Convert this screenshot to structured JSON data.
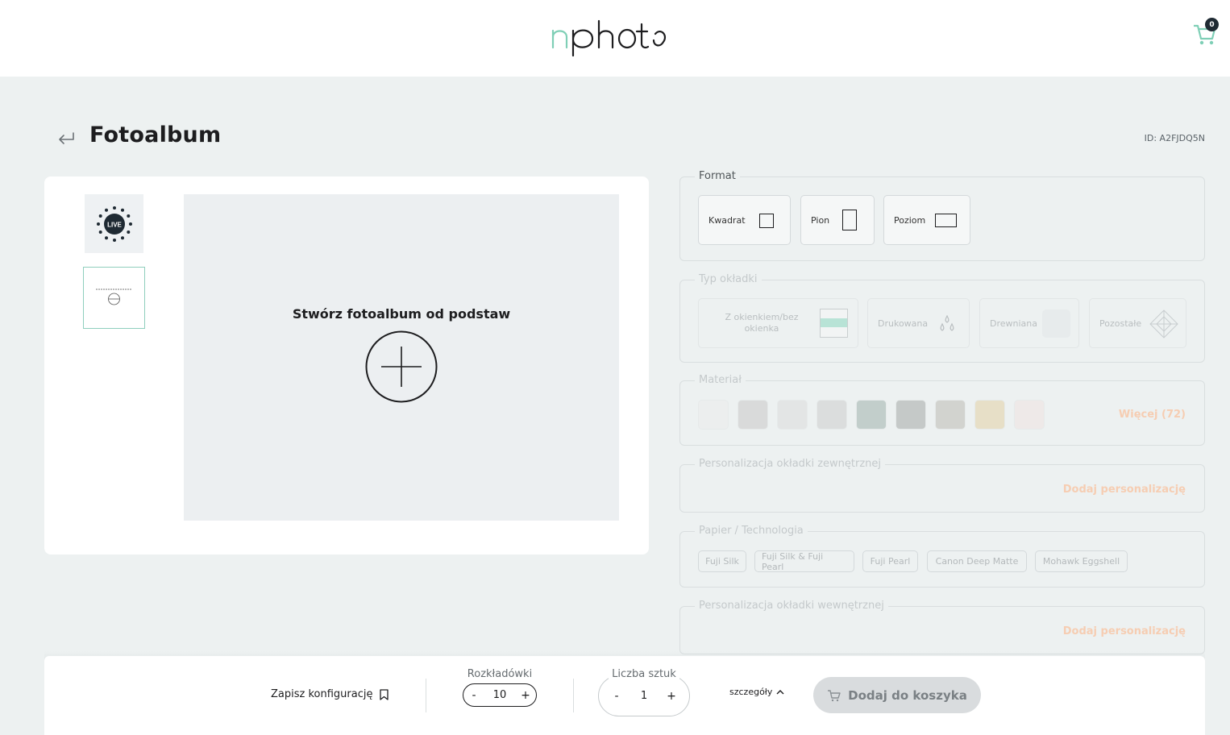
{
  "header": {
    "logo_alt": "nphoto",
    "cart_count": "0"
  },
  "page": {
    "title": "Fotoalbum",
    "id_text": "ID: A2FJDQ5N"
  },
  "preview": {
    "live_badge": "LIVE",
    "canvas_title": "Stwórz fotoalbum od podstaw"
  },
  "options": {
    "format": {
      "legend": "Format",
      "items": [
        {
          "label": "Kwadrat",
          "icon": "square-format-icon"
        },
        {
          "label": "Pion",
          "icon": "portrait-format-icon"
        },
        {
          "label": "Poziom",
          "icon": "landscape-format-icon"
        }
      ]
    },
    "cover_type": {
      "legend": "Typ okładki",
      "items": [
        {
          "label": "Z okienkiem/bez okienka",
          "icon": "window-cover-icon"
        },
        {
          "label": "Drukowana",
          "icon": "ink-drops-icon"
        },
        {
          "label": "Drewniana",
          "icon": "wood-cover-icon"
        },
        {
          "label": "Pozostałe",
          "icon": "pattern-icon"
        }
      ]
    },
    "material": {
      "legend": "Materiał",
      "swatch_colors": [
        "#ececec",
        "#c9c9c9",
        "#dcdcdc",
        "#cdcdcd",
        "#9fb3ad",
        "#a6aaa8",
        "#bdbcb4",
        "#e3d2a6",
        "#efe3e1"
      ],
      "more_label": "Więcej (72)"
    },
    "outer_personalization": {
      "legend": "Personalizacja okładki zewnętrznej",
      "action": "Dodaj personalizację"
    },
    "paper": {
      "legend": "Papier / Technologia",
      "items": [
        "Fuji Silk",
        "Fuji Silk & Fuji Pearl",
        "Fuji Pearl",
        "Canon Deep Matte",
        "Mohawk Eggshell"
      ]
    },
    "inner_personalization": {
      "legend": "Personalizacja okładki wewnętrznej",
      "action": "Dodaj personalizację"
    }
  },
  "bottom": {
    "save_label": "Zapisz konfigurację",
    "spreads_label": "Rozkładówki",
    "spreads_value": "10",
    "qty_label": "Liczba sztuk",
    "qty_value": "1",
    "minus": "-",
    "plus": "+",
    "details_label": "szczegóły",
    "add_to_cart": "Dodaj do koszyka"
  }
}
